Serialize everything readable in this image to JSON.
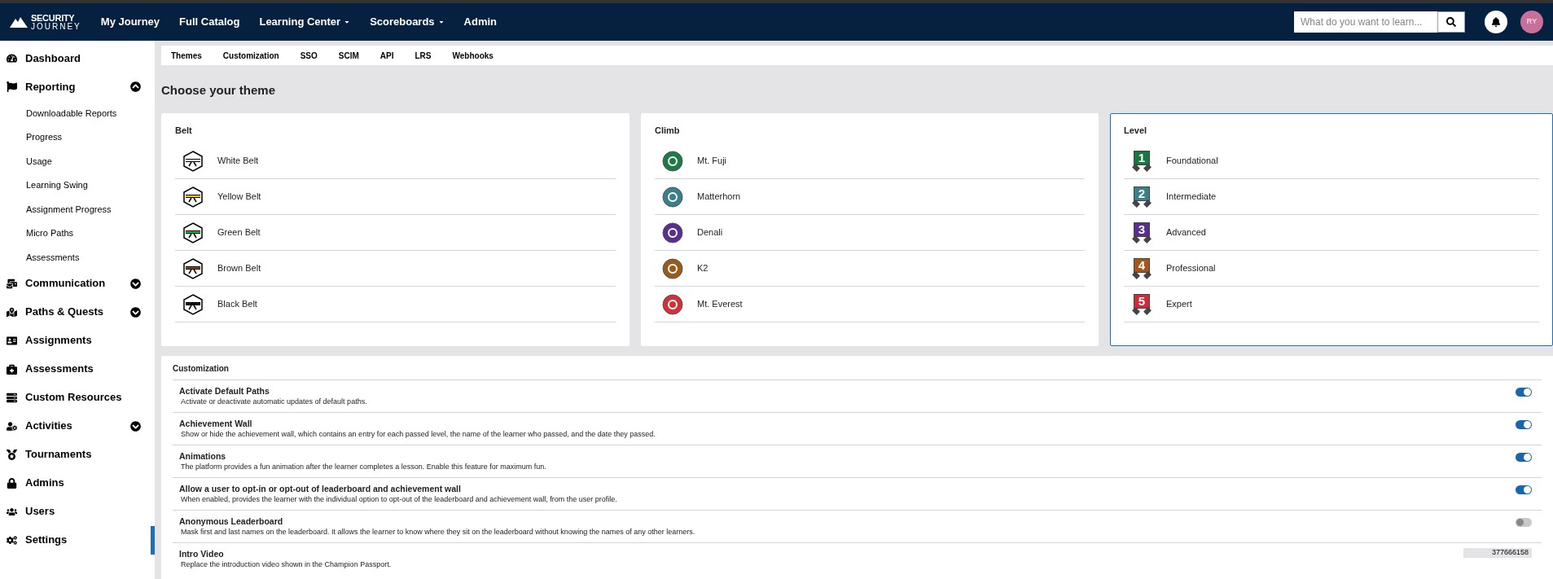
{
  "topbar": {
    "logo_line1": "SECURITY",
    "logo_line2": "JOURNEY",
    "nav": [
      {
        "label": "My Journey",
        "dropdown": false
      },
      {
        "label": "Full Catalog",
        "dropdown": false
      },
      {
        "label": "Learning Center",
        "dropdown": true
      },
      {
        "label": "Scoreboards",
        "dropdown": true
      },
      {
        "label": "Admin",
        "dropdown": false
      }
    ],
    "search": {
      "placeholder": "What do you want to learn..."
    },
    "avatar": "RY"
  },
  "sidebar": {
    "items": [
      {
        "label": "Dashboard",
        "kind": "link",
        "selected": false
      },
      {
        "label": "Reporting",
        "kind": "group",
        "expanded": true,
        "selected": false,
        "children": [
          {
            "label": "Downloadable Reports"
          },
          {
            "label": "Progress"
          },
          {
            "label": "Usage"
          },
          {
            "label": "Learning Swing"
          },
          {
            "label": "Assignment Progress"
          },
          {
            "label": "Micro Paths"
          },
          {
            "label": "Assessments"
          }
        ]
      },
      {
        "label": "Communication",
        "kind": "group",
        "expanded": false,
        "selected": false
      },
      {
        "label": "Paths & Quests",
        "kind": "group",
        "expanded": false,
        "selected": false
      },
      {
        "label": "Assignments",
        "kind": "link",
        "selected": false
      },
      {
        "label": "Assessments",
        "kind": "link",
        "selected": false
      },
      {
        "label": "Custom Resources",
        "kind": "link",
        "selected": false
      },
      {
        "label": "Activities",
        "kind": "group",
        "expanded": false,
        "selected": false
      },
      {
        "label": "Tournaments",
        "kind": "link",
        "selected": false
      },
      {
        "label": "Admins",
        "kind": "link",
        "selected": false
      },
      {
        "label": "Users",
        "kind": "link",
        "selected": false
      },
      {
        "label": "Settings",
        "kind": "link",
        "selected": true
      }
    ]
  },
  "tabs": [
    {
      "label": "Themes"
    },
    {
      "label": "Customization"
    },
    {
      "label": "SSO"
    },
    {
      "label": "SCIM"
    },
    {
      "label": "API"
    },
    {
      "label": "LRS"
    },
    {
      "label": "Webhooks"
    }
  ],
  "heading": "Choose your theme",
  "themes": [
    {
      "title": "Belt",
      "kind": "belt",
      "selected": false,
      "items": [
        {
          "label": "White Belt",
          "color": "#ffffff"
        },
        {
          "label": "Yellow Belt",
          "color": "#f5c518"
        },
        {
          "label": "Green Belt",
          "color": "#22b33a"
        },
        {
          "label": "Brown Belt",
          "color": "#8b4513"
        },
        {
          "label": "Black Belt",
          "color": "#111111"
        }
      ]
    },
    {
      "title": "Climb",
      "kind": "climb",
      "selected": false,
      "items": [
        {
          "label": "Mt. Fuji",
          "color": "#1e7a45"
        },
        {
          "label": "Matterhorn",
          "color": "#3a7f8c"
        },
        {
          "label": "Denali",
          "color": "#5a2e91"
        },
        {
          "label": "K2",
          "color": "#9a5a1c"
        },
        {
          "label": "Mt. Everest",
          "color": "#d0323c"
        }
      ]
    },
    {
      "title": "Level",
      "kind": "level",
      "selected": true,
      "items": [
        {
          "label": "Foundational",
          "color": "#17773f",
          "number": "1"
        },
        {
          "label": "Intermediate",
          "color": "#3b7f8a",
          "number": "2"
        },
        {
          "label": "Advanced",
          "color": "#5b2d92",
          "number": "3"
        },
        {
          "label": "Professional",
          "color": "#a3571d",
          "number": "4"
        },
        {
          "label": "Expert",
          "color": "#d1283a",
          "number": "5"
        }
      ]
    }
  ],
  "customization": {
    "title": "Customization",
    "rows": [
      {
        "title": "Activate Default Paths",
        "description": "Activate or deactivate automatic updates of default paths.",
        "kind": "toggle",
        "on": true
      },
      {
        "title": "Achievement Wall",
        "description": "Show or hide the achievement wall, which contains an entry for each passed level, the name of the learner who passed, and the date they passed.",
        "kind": "toggle",
        "on": true
      },
      {
        "title": "Animations",
        "description": "The platform provides a fun animation after the learner completes a lesson. Enable this feature for maximum fun.",
        "kind": "toggle",
        "on": true
      },
      {
        "title": "Allow a user to opt-in or opt-out of leaderboard and achievement wall",
        "description": "When enabled, provides the learner with the individual option to opt-out of the leaderboard and achievement wall, from the user profile.",
        "kind": "toggle",
        "on": true
      },
      {
        "title": "Anonymous Leaderboard",
        "description": "Mask first and last names on the leaderboard. It allows the learner to know where they sit on the leaderboard without knowing the names of any other learners.",
        "kind": "toggle",
        "on": false
      },
      {
        "title": "Intro Video",
        "description": "Replace the introduction video shown in the Champion Passport.",
        "kind": "text",
        "value": "377666158"
      }
    ]
  }
}
